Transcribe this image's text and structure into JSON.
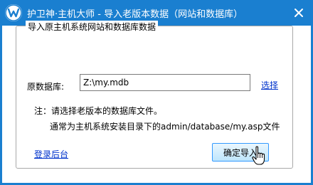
{
  "window": {
    "title": "护卫神·主机大师 - 导入老版本数据（网站和数据库）",
    "accent_color": "#1a7fd0",
    "icons": {
      "app": "shield-w-icon",
      "close": "close-icon",
      "cursor": "hand-pointer-icon"
    }
  },
  "group": {
    "legend": "导入原主机系统网站和数据库数据"
  },
  "form": {
    "db_label": "原数据库:",
    "db_value": "Z:\\my.mdb",
    "select_link": "选择"
  },
  "notes": {
    "line1": "注：请选择老版本的数据库文件。",
    "line2": "通常为主机系统安装目录下的admin/database/my.asp文件"
  },
  "footer": {
    "login_link": "登录后台",
    "confirm_button": "确定导入"
  }
}
